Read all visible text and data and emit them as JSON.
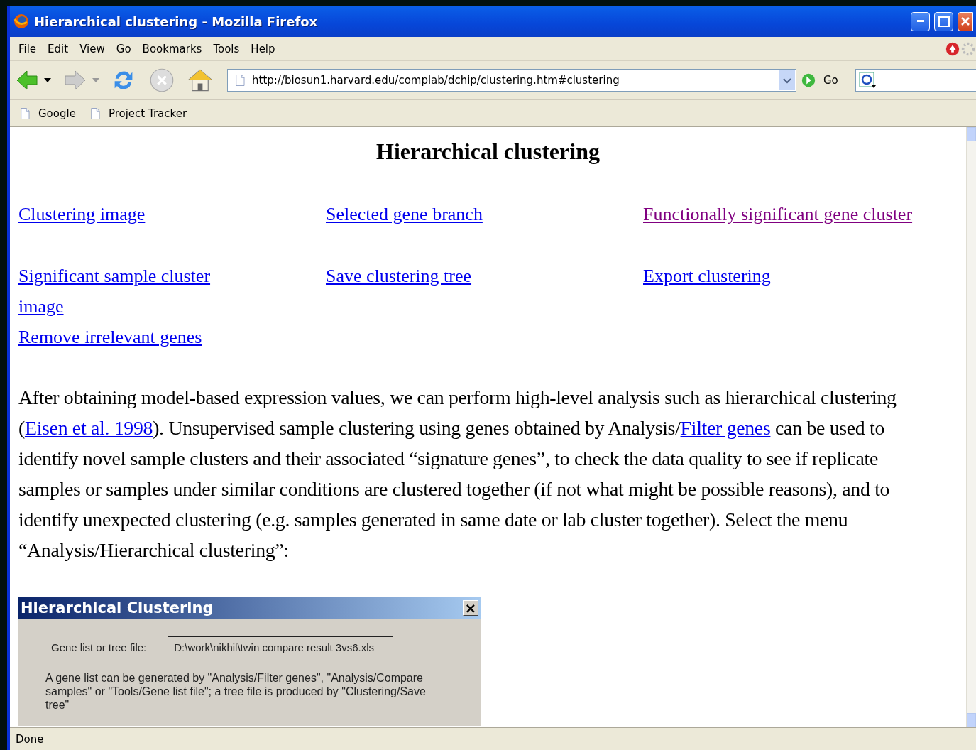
{
  "window": {
    "title": "Hierarchical clustering - Mozilla Firefox"
  },
  "menu": [
    "File",
    "Edit",
    "View",
    "Go",
    "Bookmarks",
    "Tools",
    "Help"
  ],
  "address": {
    "value": "http://biosun1.harvard.edu/complab/dchip/clustering.htm#clustering",
    "go": "Go"
  },
  "bookmarks": [
    "Google",
    "Project Tracker"
  ],
  "page": {
    "heading": "Hierarchical clustering",
    "link_rows": [
      [
        {
          "text": "Clustering image",
          "visited": false
        },
        {
          "text": "Selected gene branch",
          "visited": false
        },
        {
          "text": "Functionally significant gene cluster",
          "visited": true
        }
      ],
      [
        {
          "text": "Significant sample cluster image",
          "visited": false
        },
        {
          "text": "Save clustering tree",
          "visited": false
        },
        {
          "text": "Export clustering",
          "visited": false
        }
      ],
      [
        {
          "text": "Remove irrelevant genes",
          "visited": false
        }
      ]
    ],
    "paragraph": [
      {
        "kind": "text",
        "text": "After obtaining model-based expression values, we can perform high-level analysis such as hierarchical clustering ("
      },
      {
        "kind": "link",
        "text": "Eisen et al. 1998"
      },
      {
        "kind": "text",
        "text": "). Unsupervised sample clustering using genes obtained by Analysis/"
      },
      {
        "kind": "link",
        "text": "Filter genes"
      },
      {
        "kind": "text",
        "text": " can be used to identify novel sample clusters and their associated “signature genes”, to check the data quality to see if replicate samples or samples under similar conditions are clustered together (if not what might be possible reasons), and to identify unexpected clustering (e.g. samples generated in same date or lab cluster together). Select the menu “Analysis/Hierarchical clustering”:"
      }
    ],
    "dialog": {
      "title": "Hierarchical Clustering",
      "close": "×",
      "field_label": "Gene list or tree file:",
      "field_value": "D:\\work\\nikhil\\twin compare result 3vs6.xls",
      "hint": "A gene list can be generated by \"Analysis/Filter genes\", \"Analysis/Compare samples\" or \"Tools/Gene list file\"; a tree file is produced by \"Clustering/Save tree\""
    }
  },
  "status_bar": "Done"
}
